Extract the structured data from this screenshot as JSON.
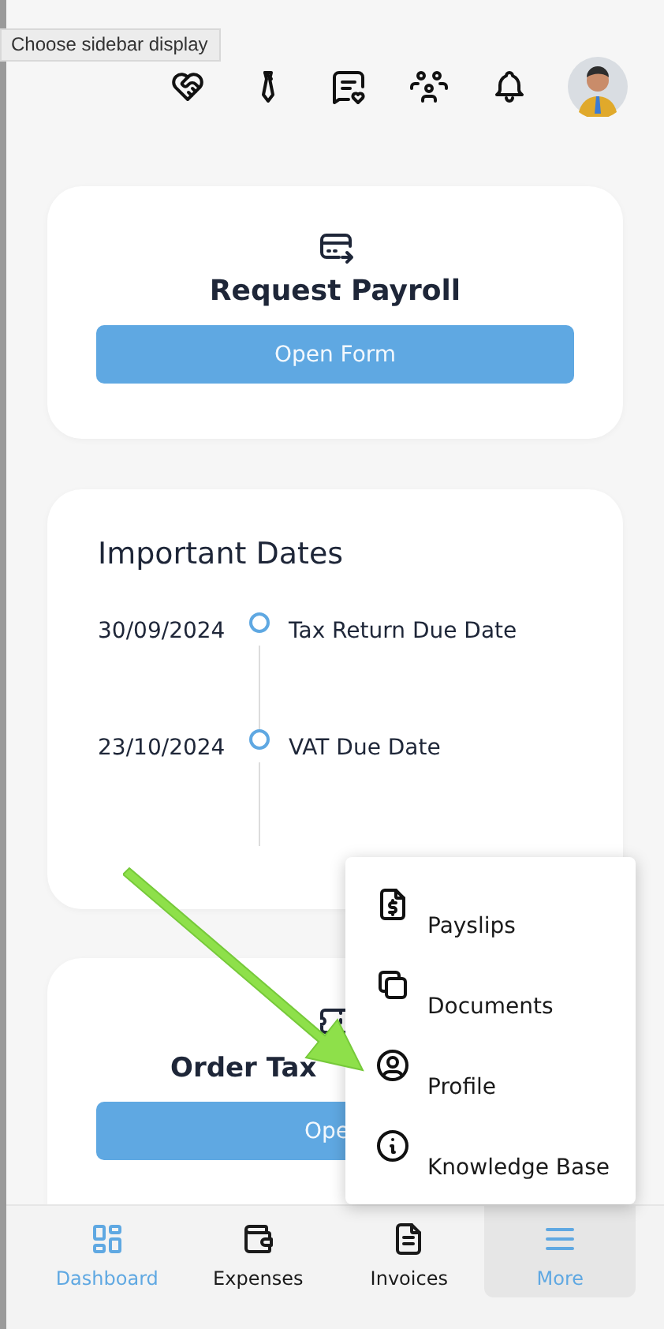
{
  "tooltip": "Choose sidebar display",
  "header_icons": [
    {
      "kind": "heart-handshake"
    },
    {
      "kind": "tie"
    },
    {
      "kind": "message-heart"
    },
    {
      "kind": "users"
    },
    {
      "kind": "bell"
    }
  ],
  "payroll_card": {
    "title": "Request Payroll",
    "button": "Open Form"
  },
  "dates_card": {
    "title": "Important Dates",
    "items": [
      {
        "date": "30/09/2024",
        "label": "Tax Return Due Date"
      },
      {
        "date": "23/10/2024",
        "label": "VAT Due Date"
      }
    ]
  },
  "tax_card": {
    "title": "Order Tax",
    "button": "Ope"
  },
  "more_menu": [
    {
      "kind": "payslip",
      "label": "Payslips"
    },
    {
      "kind": "documents",
      "label": "Documents"
    },
    {
      "kind": "profile",
      "label": "Profile"
    },
    {
      "kind": "info",
      "label": "Knowledge Base"
    }
  ],
  "bottom_nav": [
    {
      "kind": "dashboard",
      "label": "Dashboard",
      "selected": true,
      "open": false
    },
    {
      "kind": "wallet",
      "label": "Expenses",
      "selected": false,
      "open": false
    },
    {
      "kind": "invoice",
      "label": "Invoices",
      "selected": false,
      "open": false
    },
    {
      "kind": "menu",
      "label": "More",
      "selected": true,
      "open": true
    }
  ]
}
